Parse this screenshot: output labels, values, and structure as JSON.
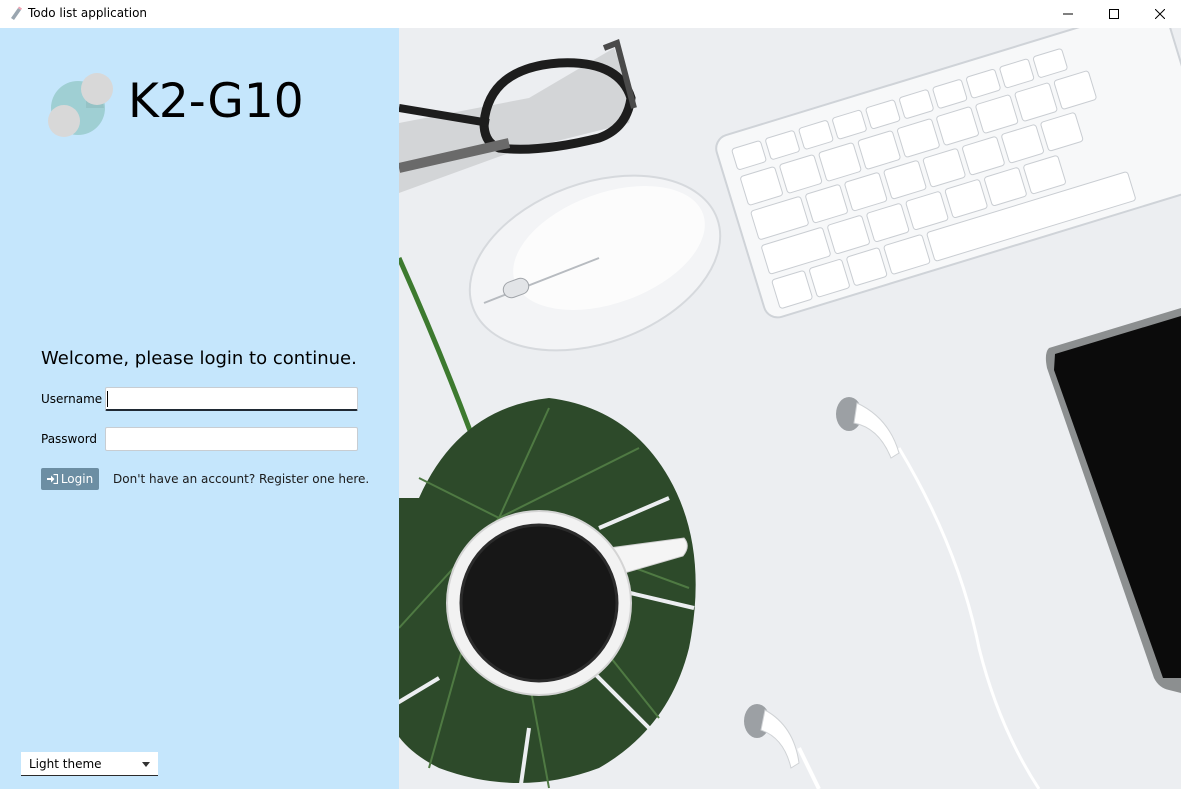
{
  "window": {
    "title": "Todo list application",
    "icon": "app-icon",
    "controls": [
      "minimize-icon",
      "maximize-icon",
      "close-icon"
    ]
  },
  "brand": {
    "name": "K2-G10",
    "logo": "circles-logo"
  },
  "login": {
    "welcome": "Welcome, please login to continue.",
    "username_label": "Username",
    "username_value": "",
    "password_label": "Password",
    "password_value": "",
    "login_button": "Login",
    "login_icon": "sign-in-icon",
    "register_text": "Don't have an account? Register one here."
  },
  "theme": {
    "selected": "Light theme"
  },
  "colors": {
    "panel_bg": "#c5e6fc",
    "button_bg": "#6c8ea3"
  }
}
